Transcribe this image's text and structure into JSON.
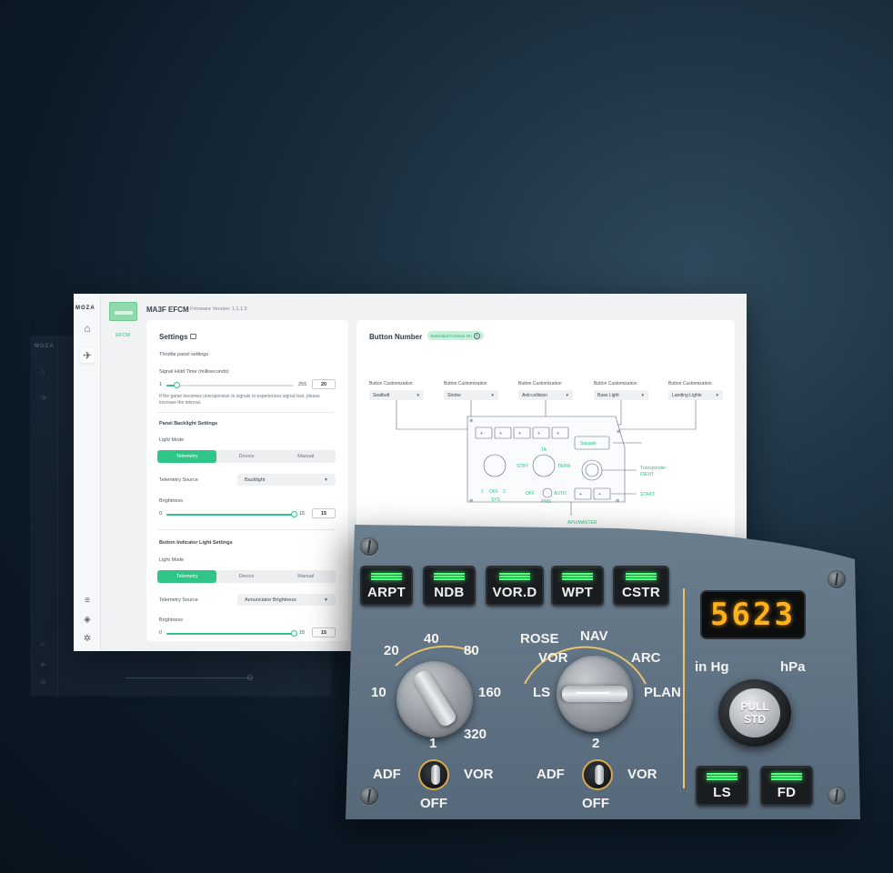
{
  "app": {
    "logo": "MOZA",
    "device_label": "EFCM",
    "title": "MA3F EFCM",
    "firmware": "Firmware Version: 1.1.1.5"
  },
  "sidebar": {
    "items": [
      {
        "icon": "home-icon"
      },
      {
        "icon": "airplane-icon"
      }
    ],
    "bottom_icons": [
      "sliders-icon",
      "cube-icon",
      "gear-icon"
    ]
  },
  "settings": {
    "title": "Settings",
    "throttle_label": "Throttle panel settings",
    "signal_hold": {
      "label": "Signal Hold Time (milliseconds)",
      "min": "1",
      "max": "255",
      "value": "20",
      "level": 0.08,
      "hint": "If the game becomes unresponsive to signals or experiences signal loss, please increase the interval."
    },
    "backlight": {
      "section": "Panel Backlight Settings",
      "light_mode_label": "Light Mode",
      "modes": [
        "Telemetry",
        "Device",
        "Manual"
      ],
      "selected_mode": "Telemetry",
      "source_label": "Telemetry Source",
      "source_value": "Backlight",
      "brightness_label": "Brightness",
      "brightness_min": "0",
      "brightness_max": "15",
      "brightness_value": "15",
      "level": 1.0
    },
    "indicator": {
      "section": "Button Indicator Light Settings",
      "light_mode_label": "Light Mode",
      "modes": [
        "Telemetry",
        "Device",
        "Manual"
      ],
      "selected_mode": "Telemetry",
      "source_label": "Telemetry Source",
      "source_value": "Annunciator Brightness",
      "brightness_label": "Brightness",
      "brightness_min": "0",
      "brightness_max": "15",
      "brightness_value": "15",
      "level": 1.0
    }
  },
  "button_panel": {
    "title": "Button Number",
    "badge": "Extended Function On",
    "customizations": [
      {
        "label": "Button Customization",
        "value": "Seatbelt"
      },
      {
        "label": "Button Customization",
        "value": "Strobe"
      },
      {
        "label": "Button Customization",
        "value": "Anti-collision"
      },
      {
        "label": "Button Customization",
        "value": "Base Light"
      },
      {
        "label": "Button Customization",
        "value": "Landing Lights"
      }
    ],
    "diagram": {
      "squawk": "Squawk",
      "ta": "TA",
      "stby": "STBY",
      "tara": "TA/RA",
      "transponder": "Transponder",
      "ident": "IDENT",
      "sys": "SYS",
      "pms": "PMS",
      "off": "OFF",
      "auto": "AUTO",
      "start": "START",
      "apu": "APU/MASTER",
      "one": "1",
      "two": "2"
    }
  },
  "hardware": {
    "keys_top": [
      "ARPT",
      "NDB",
      "VOR.D",
      "WPT",
      "CSTR"
    ],
    "display": "5623",
    "range_knob": [
      "10",
      "20",
      "40",
      "80",
      "160",
      "320"
    ],
    "mode_knob": [
      "LS",
      "VOR",
      "ROSE",
      "NAV",
      "ARC",
      "PLAN"
    ],
    "baro": {
      "left": "in Hg",
      "right": "hPa",
      "pull1": "PULL",
      "pull2": "STD"
    },
    "switch1": {
      "num": "1",
      "left": "ADF",
      "right": "VOR",
      "bottom": "OFF"
    },
    "switch2": {
      "num": "2",
      "left": "ADF",
      "right": "VOR",
      "bottom": "OFF"
    },
    "keys_bottom": [
      "LS",
      "FD"
    ],
    "accent": "#e8c36a",
    "led": "#4dff7a",
    "panel_color": "#5f7282"
  }
}
